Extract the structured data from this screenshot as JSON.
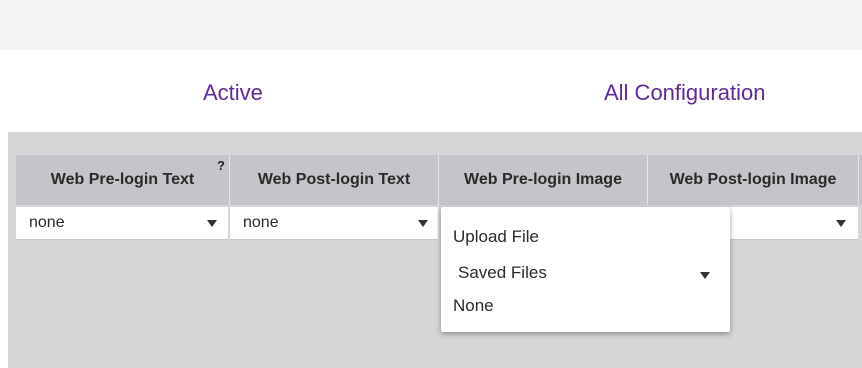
{
  "tabs": {
    "active_label": "Active",
    "all_label": "All Configuration"
  },
  "table": {
    "headers": [
      "Web Pre-login Text",
      "Web Post-login Text",
      "Web Pre-login Image",
      "Web Post-login Image"
    ],
    "help_marker": "?",
    "selects": {
      "pre_login_text": "none",
      "post_login_text": "none",
      "post_login_image": ""
    }
  },
  "dropdown": {
    "items": [
      "Upload File",
      "Saved Files",
      "None"
    ]
  },
  "colors": {
    "accent": "#5e2b97",
    "panel_bg": "#d6d6d9",
    "header_bg": "#c5c5c9"
  },
  "icons": [
    "help-icon",
    "chevron-down-icon"
  ]
}
